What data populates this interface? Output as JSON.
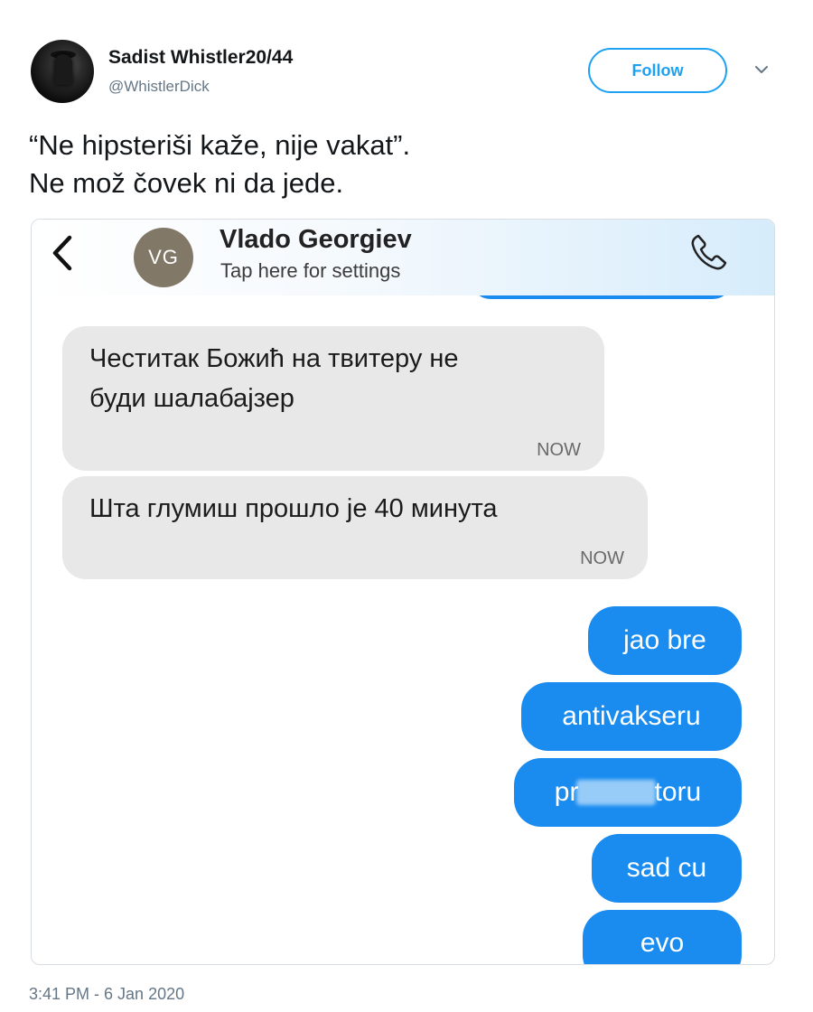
{
  "tweet": {
    "author_name": "Sadist Whistler20/44",
    "author_handle": "@WhistlerDick",
    "follow_label": "Follow",
    "text_line1": "“Ne hipsteriši kaže, nije vakat”.",
    "text_line2": "Ne mož čovek ni da jede.",
    "timestamp": "3:41 PM - 6 Jan 2020"
  },
  "chat": {
    "contact_initials": "VG",
    "contact_name": "Vlado Georgiev",
    "contact_subtitle": "Tap here for settings",
    "incoming": [
      {
        "line1": "Честитак Божић на твитеру не",
        "line2": "буди шалабајзер",
        "time": "NOW"
      },
      {
        "line1": "Шта глумиш прошло је 40 минута",
        "time": "NOW"
      }
    ],
    "outgoing": [
      {
        "text": "jao bre"
      },
      {
        "text": "antivakseru"
      },
      {
        "prefix": "pr",
        "suffix": "toru"
      },
      {
        "text": "sad cu"
      },
      {
        "text": "evo"
      }
    ]
  },
  "colors": {
    "twitter_blue": "#1da1f2",
    "imessage_blue": "#1a8cf0",
    "incoming_bubble": "#e8e8e8",
    "avatar_vg": "#827868"
  },
  "icons": [
    "caret-down-icon",
    "back-arrow-icon",
    "phone-icon"
  ]
}
